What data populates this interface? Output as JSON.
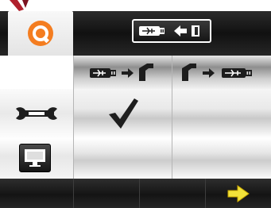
{
  "header": {
    "home_icon": "orange-ring-logo-icon",
    "mode_button_icon": "usb-to-device-arrow-icon"
  },
  "table": {
    "col_headers": [
      "usb-to-disk-icon",
      "disk-to-usb-icon"
    ],
    "rows": [
      {
        "icon": "wrench-icon",
        "col1": "checkmark-icon",
        "col2": ""
      },
      {
        "icon": "monitor-icon",
        "col1": "",
        "col2": ""
      }
    ]
  },
  "footer": {
    "next_icon": "yellow-arrow-right-icon"
  },
  "colors": {
    "accent": "#f47d20",
    "next_arrow": "#f2e23a",
    "bar_dark": "#161616"
  }
}
